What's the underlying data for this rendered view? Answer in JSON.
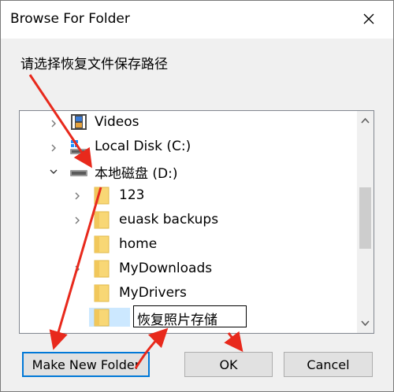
{
  "window": {
    "title": "Browse For Folder",
    "instruction": "请选择恢复文件保存路径"
  },
  "tree": {
    "items": [
      {
        "label": "Videos",
        "icon": "video-folder-icon",
        "expander": "collapsed"
      },
      {
        "label": "Local Disk (C:)",
        "icon": "windows-drive-icon",
        "expander": "collapsed"
      },
      {
        "label": "本地磁盘 (D:)",
        "icon": "drive-icon",
        "expander": "expanded"
      },
      {
        "label": "123",
        "icon": "folder-icon",
        "expander": "collapsed"
      },
      {
        "label": "euask backups",
        "icon": "folder-icon",
        "expander": "collapsed"
      },
      {
        "label": "home",
        "icon": "folder-icon",
        "expander": "none"
      },
      {
        "label": "MyDownloads",
        "icon": "folder-icon",
        "expander": "collapsed"
      },
      {
        "label": "MyDrivers",
        "icon": "folder-icon",
        "expander": "none"
      },
      {
        "label": "恢复照片存储",
        "icon": "folder-icon",
        "expander": "none",
        "editing": true
      }
    ]
  },
  "buttons": {
    "make_new_folder": "Make New Folder",
    "ok": "OK",
    "cancel": "Cancel"
  },
  "colors": {
    "annotation_arrow": "#e8291c",
    "focus_border": "#0078d7",
    "selection": "#cce8ff",
    "folder": "#f8d775"
  }
}
